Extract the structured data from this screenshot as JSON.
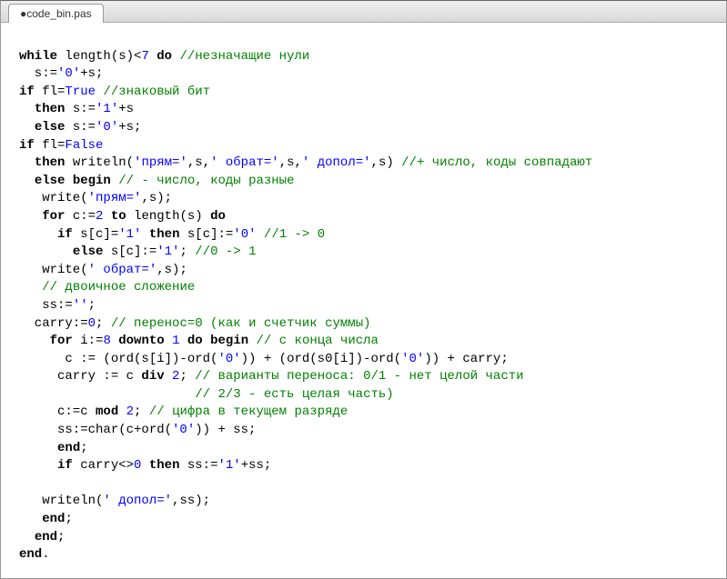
{
  "tab": {
    "title": "●code_bin.pas"
  },
  "code": {
    "lines": [
      [
        [
          "",
          ""
        ]
      ],
      [
        [
          "kw",
          "while"
        ],
        [
          "",
          " length(s)<"
        ],
        [
          "num",
          "7"
        ],
        [
          "",
          " "
        ],
        [
          "kw",
          "do"
        ],
        [
          "",
          " "
        ],
        [
          "cm",
          "//незначащие нули"
        ]
      ],
      [
        [
          "",
          "  s:="
        ],
        [
          "str",
          "'0'"
        ],
        [
          "",
          "+s;"
        ]
      ],
      [
        [
          "kw",
          "if"
        ],
        [
          "",
          " fl="
        ],
        [
          "bool",
          "True"
        ],
        [
          "",
          " "
        ],
        [
          "cm",
          "//знаковый бит"
        ]
      ],
      [
        [
          "",
          "  "
        ],
        [
          "kw",
          "then"
        ],
        [
          "",
          " s:="
        ],
        [
          "str",
          "'1'"
        ],
        [
          "",
          "+s"
        ]
      ],
      [
        [
          "",
          "  "
        ],
        [
          "kw",
          "else"
        ],
        [
          "",
          " s:="
        ],
        [
          "str",
          "'0'"
        ],
        [
          "",
          "+s;"
        ]
      ],
      [
        [
          "kw",
          "if"
        ],
        [
          "",
          " fl="
        ],
        [
          "bool",
          "False"
        ]
      ],
      [
        [
          "",
          "  "
        ],
        [
          "kw",
          "then"
        ],
        [
          "",
          " writeln("
        ],
        [
          "str",
          "'прям='"
        ],
        [
          "",
          ",s,"
        ],
        [
          "str",
          "' обрат='"
        ],
        [
          "",
          ",s,"
        ],
        [
          "str",
          "' допол='"
        ],
        [
          "",
          ",s) "
        ],
        [
          "cm",
          "//+ число, коды совпадают"
        ]
      ],
      [
        [
          "",
          "  "
        ],
        [
          "kw",
          "else"
        ],
        [
          "",
          " "
        ],
        [
          "kw",
          "begin"
        ],
        [
          "",
          " "
        ],
        [
          "cm",
          "// - число, коды разные"
        ]
      ],
      [
        [
          "",
          "   write("
        ],
        [
          "str",
          "'прям='"
        ],
        [
          "",
          ",s);"
        ]
      ],
      [
        [
          "",
          "   "
        ],
        [
          "kw",
          "for"
        ],
        [
          "",
          " c:="
        ],
        [
          "num",
          "2"
        ],
        [
          "",
          " "
        ],
        [
          "kw",
          "to"
        ],
        [
          "",
          " length(s) "
        ],
        [
          "kw",
          "do"
        ]
      ],
      [
        [
          "",
          "     "
        ],
        [
          "kw",
          "if"
        ],
        [
          "",
          " s[c]="
        ],
        [
          "str",
          "'1'"
        ],
        [
          "",
          " "
        ],
        [
          "kw",
          "then"
        ],
        [
          "",
          " s[c]:="
        ],
        [
          "str",
          "'0'"
        ],
        [
          "",
          " "
        ],
        [
          "cm",
          "//1 -> 0"
        ]
      ],
      [
        [
          "",
          "       "
        ],
        [
          "kw",
          "else"
        ],
        [
          "",
          " s[c]:="
        ],
        [
          "str",
          "'1'"
        ],
        [
          "",
          "; "
        ],
        [
          "cm",
          "//0 -> 1"
        ]
      ],
      [
        [
          "",
          "   write("
        ],
        [
          "str",
          "' обрат='"
        ],
        [
          "",
          ",s);"
        ]
      ],
      [
        [
          "",
          "   "
        ],
        [
          "cm",
          "// двоичное сложение"
        ]
      ],
      [
        [
          "",
          "   ss:="
        ],
        [
          "str",
          "''"
        ],
        [
          "",
          ";"
        ]
      ],
      [
        [
          "",
          "  carry:="
        ],
        [
          "num",
          "0"
        ],
        [
          "",
          "; "
        ],
        [
          "cm",
          "// перенос=0 (как и счетчик суммы)"
        ]
      ],
      [
        [
          "",
          "    "
        ],
        [
          "kw",
          "for"
        ],
        [
          "",
          " i:="
        ],
        [
          "num",
          "8"
        ],
        [
          "",
          " "
        ],
        [
          "kw",
          "downto"
        ],
        [
          "",
          " "
        ],
        [
          "num",
          "1"
        ],
        [
          "",
          " "
        ],
        [
          "kw",
          "do"
        ],
        [
          "",
          " "
        ],
        [
          "kw",
          "begin"
        ],
        [
          "",
          " "
        ],
        [
          "cm",
          "// с конца числа"
        ]
      ],
      [
        [
          "",
          "      c := (ord(s[i])-ord("
        ],
        [
          "str",
          "'0'"
        ],
        [
          "",
          ")) + (ord(s0[i])-ord("
        ],
        [
          "str",
          "'0'"
        ],
        [
          "",
          ")) + carry;"
        ]
      ],
      [
        [
          "",
          "     carry := c "
        ],
        [
          "kw",
          "div"
        ],
        [
          "",
          " "
        ],
        [
          "num",
          "2"
        ],
        [
          "",
          "; "
        ],
        [
          "cm",
          "// варианты переноса: 0/1 - нет целой части"
        ]
      ],
      [
        [
          "",
          "                       "
        ],
        [
          "cm",
          "// 2/3 - есть целая часть)"
        ]
      ],
      [
        [
          "",
          "     c:=c "
        ],
        [
          "kw",
          "mod"
        ],
        [
          "",
          " "
        ],
        [
          "num",
          "2"
        ],
        [
          "",
          "; "
        ],
        [
          "cm",
          "// цифра в текущем разряде"
        ]
      ],
      [
        [
          "",
          "     ss:=char(c+ord("
        ],
        [
          "str",
          "'0'"
        ],
        [
          "",
          ")) + ss;"
        ]
      ],
      [
        [
          "",
          "     "
        ],
        [
          "kw",
          "end"
        ],
        [
          "",
          ";"
        ]
      ],
      [
        [
          "",
          "     "
        ],
        [
          "kw",
          "if"
        ],
        [
          "",
          " carry<>"
        ],
        [
          "num",
          "0"
        ],
        [
          "",
          " "
        ],
        [
          "kw",
          "then"
        ],
        [
          "",
          " ss:="
        ],
        [
          "str",
          "'1'"
        ],
        [
          "",
          "+ss;"
        ]
      ],
      [
        [
          "",
          ""
        ]
      ],
      [
        [
          "",
          "   writeln("
        ],
        [
          "str",
          "' допол='"
        ],
        [
          "",
          ",ss);"
        ]
      ],
      [
        [
          "",
          "   "
        ],
        [
          "kw",
          "end"
        ],
        [
          "",
          ";"
        ]
      ],
      [
        [
          "",
          "  "
        ],
        [
          "kw",
          "end"
        ],
        [
          "",
          ";"
        ]
      ],
      [
        [
          "kw",
          "end"
        ],
        [
          "",
          "."
        ]
      ]
    ]
  }
}
